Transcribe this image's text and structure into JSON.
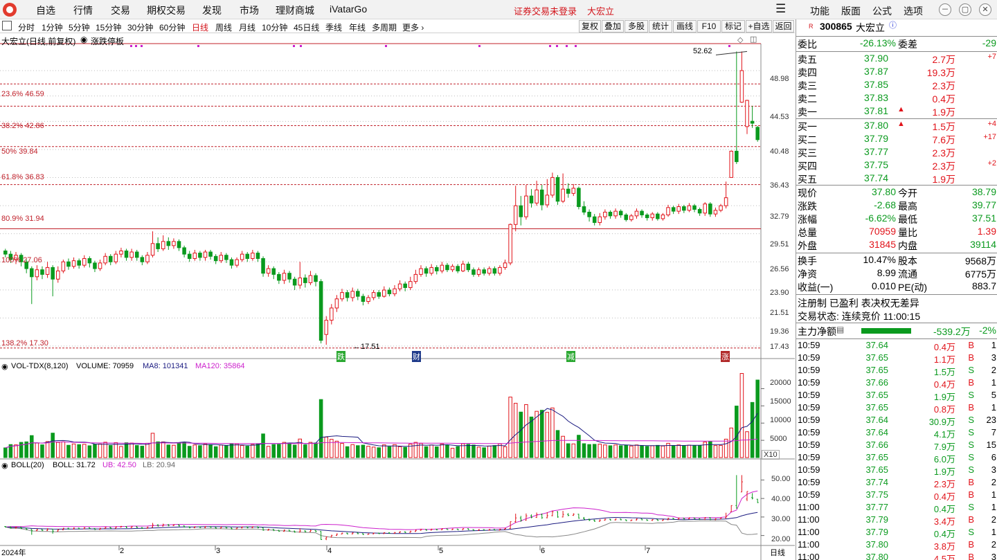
{
  "menubar": {
    "items": [
      "自选",
      "行情",
      "交易",
      "期权交易",
      "发现",
      "市场",
      "理财商城",
      "iVatarGo"
    ],
    "status": "证券交易未登录",
    "stock": "大宏立",
    "right_items": [
      "功能",
      "版面",
      "公式",
      "选项"
    ],
    "window_buttons": [
      "－",
      "▢",
      "✕"
    ]
  },
  "toolbar": {
    "periods": [
      "分时",
      "1分钟",
      "5分钟",
      "15分钟",
      "30分钟",
      "60分钟",
      "日线",
      "周线",
      "月线",
      "10分钟",
      "45日线",
      "季线",
      "年线",
      "多周期",
      "更多 ›"
    ],
    "active_period": "日线",
    "buttons": [
      "复权",
      "叠加",
      "多股",
      "统计",
      "画线",
      "F10",
      "标记",
      "+自选",
      "返回"
    ]
  },
  "main_chart": {
    "title": "大宏立(日线,前复权)",
    "indicator_tab": "涨跌停板",
    "price_axis": [
      "48.98",
      "44.53",
      "40.48",
      "36.43",
      "32.79",
      "29.51",
      "26.56",
      "23.90",
      "21.51",
      "19.36",
      "17.43"
    ],
    "fib_levels": [
      "23.6% 46.59",
      "38.2% 42.86",
      "50% 39.84",
      "61.8% 36.83",
      "80.9% 31.94",
      "100% 27.06",
      "138.2% 17.30"
    ],
    "high_mark": "52.62",
    "low_mark": "←17.51",
    "event_markers": [
      "跌",
      "财",
      "减",
      "涨"
    ]
  },
  "volume_panel": {
    "label": "VOL-TDX(8,120)",
    "volume": "VOLUME: 70959",
    "ma8": "MA8: 101341",
    "ma120": "MA120: 35864",
    "axis": [
      "20000",
      "15000",
      "10000",
      "5000"
    ],
    "unit": "X10"
  },
  "boll_panel": {
    "label": "BOLL(20)",
    "boll": "BOLL: 31.72",
    "ub": "UB: 42.50",
    "lb": "LB: 20.94",
    "axis": [
      "50.00",
      "40.00",
      "30.00",
      "20.00"
    ]
  },
  "date_axis": {
    "labels": [
      "2024年",
      "2",
      "3",
      "4",
      "5",
      "6",
      "7"
    ],
    "period": "日线"
  },
  "quote": {
    "code": "300865",
    "name": "大宏立",
    "weibi_label": "委比",
    "weibi": "-26.13%",
    "weicha_label": "委差",
    "weicha": "-29",
    "asks": [
      {
        "label": "卖五",
        "price": "37.90",
        "vol": "2.7万",
        "chg": "+7"
      },
      {
        "label": "卖四",
        "price": "37.87",
        "vol": "19.3万",
        "chg": ""
      },
      {
        "label": "卖三",
        "price": "37.85",
        "vol": "2.3万",
        "chg": ""
      },
      {
        "label": "卖二",
        "price": "37.83",
        "vol": "0.4万",
        "chg": ""
      },
      {
        "label": "卖一",
        "price": "37.81",
        "vol": "1.9万",
        "chg": ""
      }
    ],
    "bids": [
      {
        "label": "买一",
        "price": "37.80",
        "vol": "1.5万",
        "chg": "+4"
      },
      {
        "label": "买二",
        "price": "37.79",
        "vol": "7.6万",
        "chg": "+17"
      },
      {
        "label": "买三",
        "price": "37.77",
        "vol": "2.3万",
        "chg": ""
      },
      {
        "label": "买四",
        "price": "37.75",
        "vol": "2.3万",
        "chg": "+2"
      },
      {
        "label": "买五",
        "price": "37.74",
        "vol": "1.9万",
        "chg": ""
      }
    ],
    "stats": [
      {
        "l1": "现价",
        "v1": "37.80",
        "l2": "今开",
        "v2": "38.79"
      },
      {
        "l1": "涨跌",
        "v1": "-2.68",
        "l2": "最高",
        "v2": "39.77"
      },
      {
        "l1": "涨幅",
        "v1": "-6.62%",
        "l2": "最低",
        "v2": "37.51"
      },
      {
        "l1": "总量",
        "v1": "70959",
        "l2": "量比",
        "v2": "1.39"
      },
      {
        "l1": "外盘",
        "v1": "31845",
        "l2": "内盘",
        "v2": "39114"
      }
    ],
    "stats2": [
      {
        "l1": "换手",
        "v1": "10.47%",
        "l2": "股本",
        "v2": "9568万"
      },
      {
        "l1": "净资",
        "v1": "8.99",
        "l2": "流通",
        "v2": "6775万"
      },
      {
        "l1": "收益(一)",
        "v1": "0.010",
        "l2": "PE(动)",
        "v2": "883.7"
      }
    ],
    "notice": "注册制 已盈利 表决权无差异",
    "trade_state": "交易状态: 连续竞价 11:00:15",
    "main_flow_label": "主力净额",
    "main_flow": "-539.2万",
    "main_flow_pct": "-2%",
    "ticks": [
      {
        "t": "10:59",
        "p": "37.64",
        "v": "0.4万",
        "s": "B",
        "n": "1"
      },
      {
        "t": "10:59",
        "p": "37.65",
        "v": "1.1万",
        "s": "B",
        "n": "3"
      },
      {
        "t": "10:59",
        "p": "37.65",
        "v": "1.5万",
        "s": "S",
        "n": "2"
      },
      {
        "t": "10:59",
        "p": "37.66",
        "v": "0.4万",
        "s": "B",
        "n": "1"
      },
      {
        "t": "10:59",
        "p": "37.65",
        "v": "1.9万",
        "s": "S",
        "n": "5"
      },
      {
        "t": "10:59",
        "p": "37.65",
        "v": "0.8万",
        "s": "B",
        "n": "1"
      },
      {
        "t": "10:59",
        "p": "37.64",
        "v": "30.9万",
        "s": "S",
        "n": "23"
      },
      {
        "t": "10:59",
        "p": "37.64",
        "v": "4.1万",
        "s": "S",
        "n": "7"
      },
      {
        "t": "10:59",
        "p": "37.66",
        "v": "7.9万",
        "s": "S",
        "n": "15"
      },
      {
        "t": "10:59",
        "p": "37.65",
        "v": "6.0万",
        "s": "S",
        "n": "6"
      },
      {
        "t": "10:59",
        "p": "37.65",
        "v": "1.9万",
        "s": "S",
        "n": "3"
      },
      {
        "t": "10:59",
        "p": "37.74",
        "v": "2.3万",
        "s": "B",
        "n": "2"
      },
      {
        "t": "10:59",
        "p": "37.75",
        "v": "0.4万",
        "s": "B",
        "n": "1"
      },
      {
        "t": "11:00",
        "p": "37.77",
        "v": "0.4万",
        "s": "S",
        "n": "1"
      },
      {
        "t": "11:00",
        "p": "37.79",
        "v": "3.4万",
        "s": "B",
        "n": "2"
      },
      {
        "t": "11:00",
        "p": "37.79",
        "v": "0.4万",
        "s": "S",
        "n": "1"
      },
      {
        "t": "11:00",
        "p": "37.80",
        "v": "3.8万",
        "s": "B",
        "n": "2"
      },
      {
        "t": "11:00",
        "p": "37.80",
        "v": "4.5万",
        "s": "B",
        "n": "3"
      }
    ]
  },
  "colors": {
    "up": "#e1131a",
    "down": "#0a9a1e",
    "fib_line": "#c0202a",
    "ma120": "#cc1fcc",
    "ma8": "#1a1a80"
  },
  "chart_data": {
    "type": "candlestick",
    "title": "大宏立(日线,前复权)",
    "price_range": [
      16.8,
      53.5
    ],
    "highest": 52.62,
    "lowest": 17.51,
    "candles": [
      [
        24.9,
        24.6,
        25.1,
        24.3
      ],
      [
        24.6,
        24.1,
        24.9,
        23.8
      ],
      [
        24.1,
        24.5,
        24.8,
        23.7
      ],
      [
        24.5,
        23.9,
        24.7,
        23.5
      ],
      [
        23.9,
        23.3,
        24.1,
        22.9
      ],
      [
        23.3,
        22.6,
        23.5,
        20.4
      ],
      [
        22.6,
        23.2,
        23.6,
        22.3
      ],
      [
        23.2,
        22.8,
        23.5,
        22.4
      ],
      [
        22.8,
        23.4,
        23.9,
        22.5
      ],
      [
        23.4,
        22.4,
        23.6,
        21.0
      ],
      [
        22.4,
        23.1,
        23.5,
        22.1
      ],
      [
        23.1,
        23.9,
        24.1,
        22.9
      ],
      [
        23.9,
        23.5,
        24.2,
        23.2
      ],
      [
        23.5,
        24.0,
        24.3,
        23.3
      ],
      [
        24.0,
        23.6,
        24.2,
        23.3
      ],
      [
        23.6,
        24.2,
        24.5,
        23.4
      ],
      [
        24.2,
        23.8,
        24.4,
        23.4
      ],
      [
        23.8,
        23.3,
        24.0,
        23.0
      ],
      [
        23.3,
        23.8,
        24.1,
        23.1
      ],
      [
        23.8,
        24.4,
        24.7,
        23.6
      ],
      [
        24.4,
        23.9,
        24.6,
        23.6
      ],
      [
        23.9,
        24.6,
        24.9,
        23.7
      ],
      [
        24.6,
        24.9,
        25.2,
        24.3
      ],
      [
        24.9,
        24.3,
        25.1,
        24.0
      ],
      [
        24.3,
        24.8,
        25.1,
        24.0
      ],
      [
        24.8,
        24.3,
        25.0,
        24.0
      ],
      [
        24.3,
        23.9,
        24.5,
        23.6
      ],
      [
        23.9,
        24.5,
        24.8,
        23.7
      ],
      [
        24.5,
        25.6,
        26.8,
        24.3
      ],
      [
        25.6,
        25.1,
        26.2,
        24.8
      ],
      [
        25.1,
        25.8,
        26.4,
        24.9
      ],
      [
        25.8,
        25.4,
        26.2,
        25.0
      ],
      [
        25.4,
        25.8,
        26.1,
        25.1
      ],
      [
        25.8,
        25.2,
        26.0,
        24.9
      ],
      [
        25.2,
        24.6,
        25.4,
        24.3
      ],
      [
        24.6,
        24.2,
        24.9,
        23.9
      ],
      [
        24.2,
        24.7,
        25.0,
        24.0
      ],
      [
        24.7,
        24.3,
        24.9,
        24.0
      ],
      [
        24.3,
        24.8,
        25.0,
        24.0
      ],
      [
        24.8,
        24.4,
        25.0,
        24.1
      ],
      [
        24.4,
        24.0,
        24.6,
        23.7
      ],
      [
        24.0,
        24.5,
        24.8,
        23.8
      ],
      [
        24.5,
        24.1,
        24.7,
        23.8
      ],
      [
        24.1,
        23.6,
        24.3,
        23.3
      ],
      [
        23.6,
        24.1,
        24.3,
        23.4
      ],
      [
        24.1,
        24.6,
        24.9,
        23.9
      ],
      [
        24.6,
        24.2,
        24.8,
        23.9
      ],
      [
        24.2,
        24.7,
        25.0,
        24.0
      ],
      [
        24.7,
        24.2,
        24.9,
        23.9
      ],
      [
        24.2,
        22.9,
        24.4,
        22.6
      ],
      [
        22.9,
        23.3,
        23.6,
        22.6
      ],
      [
        23.3,
        22.8,
        23.5,
        22.4
      ],
      [
        22.8,
        22.3,
        23.0,
        22.0
      ],
      [
        22.3,
        22.9,
        23.2,
        22.0
      ],
      [
        22.9,
        22.4,
        23.1,
        22.1
      ],
      [
        22.4,
        21.9,
        22.6,
        21.5
      ],
      [
        21.9,
        22.5,
        23.9,
        21.6
      ],
      [
        22.5,
        22.1,
        22.8,
        21.7
      ],
      [
        22.1,
        22.7,
        23.1,
        21.9
      ],
      [
        22.7,
        22.2,
        22.9,
        21.8
      ],
      [
        22.2,
        17.8,
        22.4,
        17.6
      ],
      [
        18.2,
        19.2,
        19.5,
        17.51
      ],
      [
        19.2,
        20.1,
        20.4,
        18.9
      ],
      [
        20.1,
        20.8,
        21.1,
        19.8
      ],
      [
        20.8,
        21.3,
        21.6,
        20.6
      ],
      [
        21.3,
        20.9,
        21.5,
        20.6
      ],
      [
        20.9,
        21.4,
        21.7,
        20.6
      ],
      [
        21.4,
        21.0,
        21.6,
        20.7
      ],
      [
        21.0,
        20.6,
        21.2,
        20.3
      ],
      [
        20.6,
        20.9,
        21.1,
        20.4
      ],
      [
        20.9,
        21.3,
        21.5,
        20.7
      ],
      [
        21.3,
        21.0,
        21.5,
        20.8
      ],
      [
        21.0,
        21.5,
        21.8,
        20.9
      ],
      [
        21.5,
        21.2,
        21.7,
        21.0
      ],
      [
        21.2,
        21.6,
        21.9,
        21.0
      ],
      [
        21.6,
        22.0,
        22.3,
        21.4
      ],
      [
        22.0,
        21.7,
        22.2,
        21.4
      ],
      [
        21.7,
        22.2,
        22.6,
        21.5
      ],
      [
        22.2,
        22.8,
        23.2,
        22.0
      ],
      [
        22.8,
        23.3,
        23.6,
        22.6
      ],
      [
        23.3,
        22.9,
        23.5,
        22.6
      ],
      [
        22.9,
        23.4,
        23.7,
        22.7
      ],
      [
        23.4,
        23.1,
        23.6,
        22.8
      ],
      [
        23.1,
        23.6,
        23.9,
        22.9
      ],
      [
        23.6,
        23.2,
        23.8,
        23.0
      ],
      [
        23.2,
        23.5,
        23.7,
        23.0
      ],
      [
        23.5,
        23.1,
        23.7,
        22.9
      ],
      [
        23.1,
        23.7,
        24.0,
        23.0
      ],
      [
        23.7,
        23.2,
        23.9,
        23.0
      ],
      [
        23.2,
        22.8,
        23.4,
        22.6
      ],
      [
        22.8,
        23.2,
        23.4,
        22.6
      ],
      [
        23.2,
        22.9,
        23.4,
        22.7
      ],
      [
        22.9,
        23.3,
        23.5,
        22.7
      ],
      [
        23.3,
        22.9,
        23.5,
        22.7
      ],
      [
        22.9,
        23.4,
        23.6,
        22.7
      ],
      [
        23.4,
        23.8,
        24.1,
        23.2
      ],
      [
        23.8,
        27.5,
        27.6,
        23.6
      ],
      [
        27.5,
        29.5,
        31.8,
        26.8
      ],
      [
        29.5,
        28.3,
        30.6,
        27.4
      ],
      [
        28.3,
        30.6,
        31.9,
        28.0
      ],
      [
        30.6,
        29.8,
        31.4,
        29.3
      ],
      [
        29.8,
        31.3,
        32.4,
        29.5
      ],
      [
        31.3,
        29.6,
        31.9,
        29.0
      ],
      [
        29.6,
        30.7,
        32.6,
        29.3
      ],
      [
        30.7,
        32.8,
        33.4,
        30.4
      ],
      [
        32.8,
        30.0,
        33.1,
        29.6
      ],
      [
        30.0,
        31.4,
        33.3,
        29.8
      ],
      [
        31.4,
        30.9,
        32.1,
        30.4
      ],
      [
        30.9,
        31.5,
        32.0,
        30.6
      ],
      [
        31.5,
        29.4,
        31.7,
        29.1
      ],
      [
        29.4,
        28.8,
        30.0,
        28.5
      ],
      [
        28.8,
        28.3,
        29.1,
        27.8
      ],
      [
        28.3,
        27.7,
        28.6,
        27.4
      ],
      [
        27.7,
        28.3,
        28.7,
        27.4
      ],
      [
        28.3,
        28.8,
        29.1,
        28.0
      ],
      [
        28.8,
        28.4,
        29.0,
        28.1
      ],
      [
        28.4,
        28.9,
        29.2,
        28.1
      ],
      [
        28.9,
        28.5,
        29.1,
        28.2
      ],
      [
        28.5,
        28.0,
        28.7,
        27.8
      ],
      [
        28.0,
        28.4,
        28.6,
        27.8
      ],
      [
        28.4,
        28.9,
        29.2,
        28.1
      ],
      [
        28.9,
        28.5,
        29.1,
        28.2
      ],
      [
        28.5,
        28.2,
        28.7,
        27.9
      ],
      [
        28.2,
        28.6,
        28.8,
        27.9
      ],
      [
        28.6,
        28.1,
        28.8,
        27.9
      ],
      [
        28.1,
        28.5,
        28.7,
        27.9
      ],
      [
        28.5,
        29.3,
        29.6,
        28.3
      ],
      [
        29.3,
        28.9,
        29.5,
        28.6
      ],
      [
        28.9,
        29.4,
        29.7,
        28.6
      ],
      [
        29.4,
        29.0,
        29.6,
        28.7
      ],
      [
        29.0,
        29.5,
        29.8,
        28.8
      ],
      [
        29.5,
        29.1,
        29.7,
        28.8
      ],
      [
        29.1,
        28.7,
        29.3,
        28.4
      ],
      [
        28.7,
        29.7,
        29.9,
        28.4
      ],
      [
        29.7,
        28.6,
        29.9,
        28.3
      ],
      [
        28.6,
        29.0,
        29.3,
        28.3
      ],
      [
        29.0,
        29.5,
        29.7,
        28.8
      ],
      [
        29.5,
        30.4,
        32.3,
        29.2
      ],
      [
        32.8,
        36.2,
        36.3,
        32.8
      ],
      [
        36.2,
        34.8,
        52.62,
        34.5
      ],
      [
        43.5,
        48.98,
        52.62,
        43.4
      ],
      [
        39.7,
        43.8,
        43.9,
        38.6
      ],
      [
        40.5,
        40.2,
        42.9,
        39.5
      ],
      [
        39.6,
        37.8,
        39.8,
        37.51
      ]
    ]
  }
}
